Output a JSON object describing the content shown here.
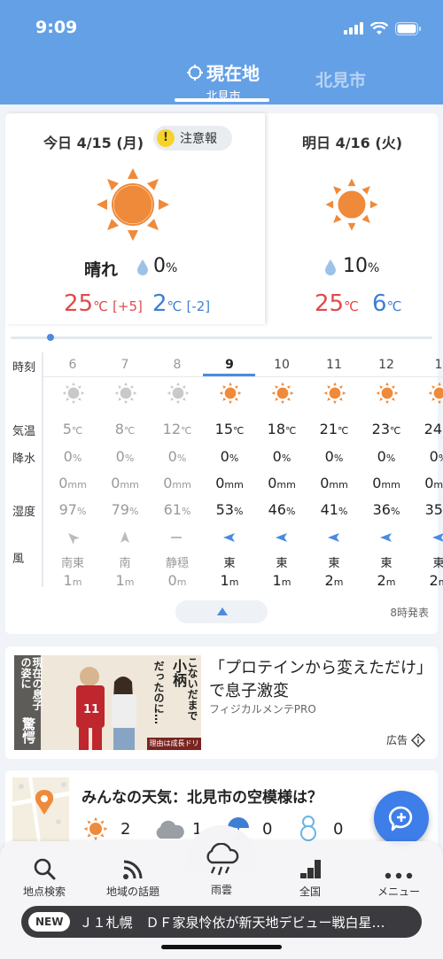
{
  "status_bar": {
    "time": "9:09"
  },
  "tabs": {
    "current": {
      "title": "現在地",
      "subtitle": "北見市"
    },
    "other": {
      "title": "北見市"
    }
  },
  "today": {
    "title": "今日 4/15 (月)",
    "alert_label": "注意報",
    "weather": "晴れ",
    "precip": "0",
    "precip_unit": "%",
    "high": "25",
    "high_diff": "[+5]",
    "low": "2",
    "low_diff": "[-2]",
    "unit": "℃"
  },
  "tomorrow": {
    "title": "明日 4/16 (火)",
    "precip": "10",
    "precip_unit": "%",
    "high": "25",
    "low": "6",
    "unit": "℃"
  },
  "hourly": {
    "labels": {
      "time": "時刻",
      "temp": "気温",
      "precip": "降水",
      "humidity": "湿度",
      "wind": "風"
    },
    "hours": [
      {
        "hour": "6",
        "temp": "5",
        "pop": "0",
        "rain": "0",
        "humidity": "97",
        "wind_dir": "南東",
        "wind_speed": "1"
      },
      {
        "hour": "7",
        "temp": "8",
        "pop": "0",
        "rain": "0",
        "humidity": "79",
        "wind_dir": "南",
        "wind_speed": "1"
      },
      {
        "hour": "8",
        "temp": "12",
        "pop": "0",
        "rain": "0",
        "humidity": "61",
        "wind_dir": "静穏",
        "wind_speed": "0"
      },
      {
        "hour": "9",
        "temp": "15",
        "pop": "0",
        "rain": "0",
        "humidity": "53",
        "wind_dir": "東",
        "wind_speed": "1"
      },
      {
        "hour": "10",
        "temp": "18",
        "pop": "0",
        "rain": "0",
        "humidity": "46",
        "wind_dir": "東",
        "wind_speed": "1"
      },
      {
        "hour": "11",
        "temp": "21",
        "pop": "0",
        "rain": "0",
        "humidity": "41",
        "wind_dir": "東",
        "wind_speed": "2"
      },
      {
        "hour": "12",
        "temp": "23",
        "pop": "0",
        "rain": "0",
        "humidity": "36",
        "wind_dir": "東",
        "wind_speed": "2"
      },
      {
        "hour": "1",
        "temp": "24",
        "pop": "0",
        "rain": "0",
        "humidity": "35",
        "wind_dir": "東",
        "wind_speed": "2"
      }
    ],
    "units": {
      "temp": "℃",
      "pop": "%",
      "rain": "mm",
      "humidity": "%",
      "wind": "m"
    },
    "issued": "8時発表"
  },
  "ad": {
    "title": "「プロテインから変えただけ」で息子激変",
    "sponsor": "フィジカルメンテPRO",
    "badge": "広告",
    "image_text": {
      "left": "現在の息子の姿に",
      "left_big": "驚愕",
      "right": "こないだまで",
      "right_big": "小柄",
      "right_tail": "だったのに…",
      "footer": "理由は成長ドリンク",
      "jersey": "11"
    }
  },
  "users": {
    "title": "みんなの天気：北見市の空模様は？",
    "counts": [
      "2",
      "1",
      "0",
      "0"
    ]
  },
  "nav": [
    {
      "label": "地点検索",
      "icon": "search-icon"
    },
    {
      "label": "地域の話題",
      "icon": "rss-icon"
    },
    {
      "label": "雨雲",
      "icon": "rain-cloud-icon"
    },
    {
      "label": "全国",
      "icon": "chart-icon"
    },
    {
      "label": "メニュー",
      "icon": "more-icon"
    }
  ],
  "ticker": {
    "badge": "NEW",
    "text": "Ｊ１札幌　ＤＦ家泉怜依が新天地デビュー戦白星…"
  },
  "colors": {
    "header": "#64a0e6",
    "sun": "#ef8a3a",
    "accent": "#4a8be0",
    "red": "#e04b4b",
    "blue": "#3f7fd2"
  }
}
